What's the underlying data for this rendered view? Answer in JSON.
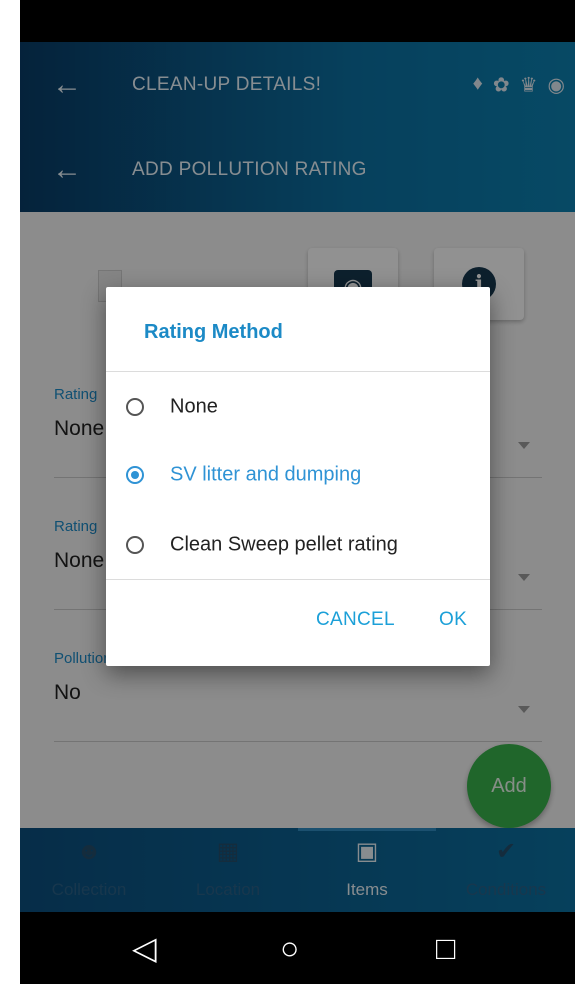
{
  "header": {
    "title": "CLEAN-UP DETAILS!",
    "back_icon": "arrow-left-icon",
    "icons": [
      "fish-icon",
      "turtle-icon",
      "lighthouse-icon",
      "globe-icon"
    ]
  },
  "subheader": {
    "title": "ADD POLLUTION RATING",
    "back_icon": "arrow-left-icon"
  },
  "form": {
    "fields": [
      {
        "label": "Rating",
        "value": "None"
      },
      {
        "label": "Rating",
        "value": "None"
      },
      {
        "label": "Pollution rating",
        "value": "No"
      }
    ],
    "camera_icon": "camera-icon",
    "info_icon": "info-icon",
    "add_button_label": "Add"
  },
  "dialog": {
    "title": "Rating Method",
    "options": [
      {
        "label": "None",
        "selected": false
      },
      {
        "label": "SV litter and dumping",
        "selected": true
      },
      {
        "label": "Clean Sweep pellet rating",
        "selected": false
      }
    ],
    "cancel_label": "CANCEL",
    "ok_label": "OK"
  },
  "bottom_nav": {
    "items": [
      {
        "label": "Collection",
        "icon": "people-icon",
        "active": false
      },
      {
        "label": "Location",
        "icon": "map-icon",
        "active": false
      },
      {
        "label": "Items",
        "icon": "clipboard-icon",
        "active": true
      },
      {
        "label": "Conditions",
        "icon": "check-circle-icon",
        "active": false
      }
    ]
  },
  "system_nav": {
    "back_icon": "triangle-back-icon",
    "home_icon": "circle-home-icon",
    "recents_icon": "square-recents-icon"
  },
  "colors": {
    "accent": "#1c8ac6",
    "radio_selected": "#2f93d5",
    "fab": "#38b04b",
    "app_bar": "#0b6fa0"
  }
}
